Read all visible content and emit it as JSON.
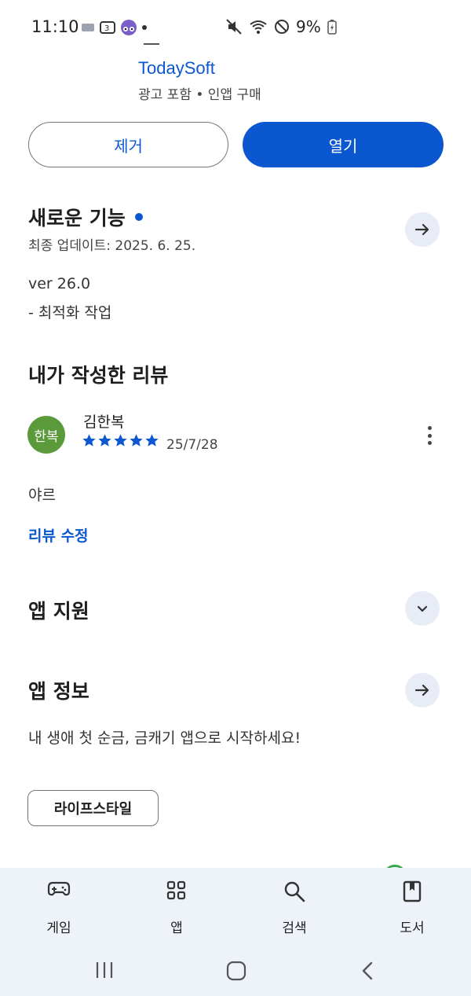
{
  "status_bar": {
    "time": "11:10",
    "battery": "9%"
  },
  "developer": {
    "name": "TodaySoft",
    "meta": "광고 포함 • 인앱 구매"
  },
  "actions": {
    "remove_label": "제거",
    "open_label": "열기"
  },
  "whats_new": {
    "title": "새로운 기능",
    "updated": "최종 업데이트: 2025. 6. 25.",
    "version": "ver 26.0",
    "note": "- 최적화 작업"
  },
  "my_review": {
    "title": "내가 작성한 리뷰",
    "avatar_text": "한복",
    "reviewer": "김한복",
    "rating": 5,
    "date": "25/7/28",
    "text": "야르",
    "edit_label": "리뷰 수정"
  },
  "app_support": {
    "title": "앱 지원"
  },
  "app_info": {
    "title": "앱 정보",
    "description": "내 생애 첫 순금, 금캐기 앱으로 시작하세요!",
    "category_chip": "라이프스타일"
  },
  "bottom_nav": {
    "items": [
      {
        "label": "게임",
        "icon": "gamepad-icon"
      },
      {
        "label": "앱",
        "icon": "apps-grid-icon"
      },
      {
        "label": "검색",
        "icon": "search-icon"
      },
      {
        "label": "도서",
        "icon": "book-icon"
      }
    ]
  },
  "colors": {
    "accent": "#0b57d0",
    "avatar": "#5a9a3a",
    "nav_bg": "#eef2f9"
  }
}
